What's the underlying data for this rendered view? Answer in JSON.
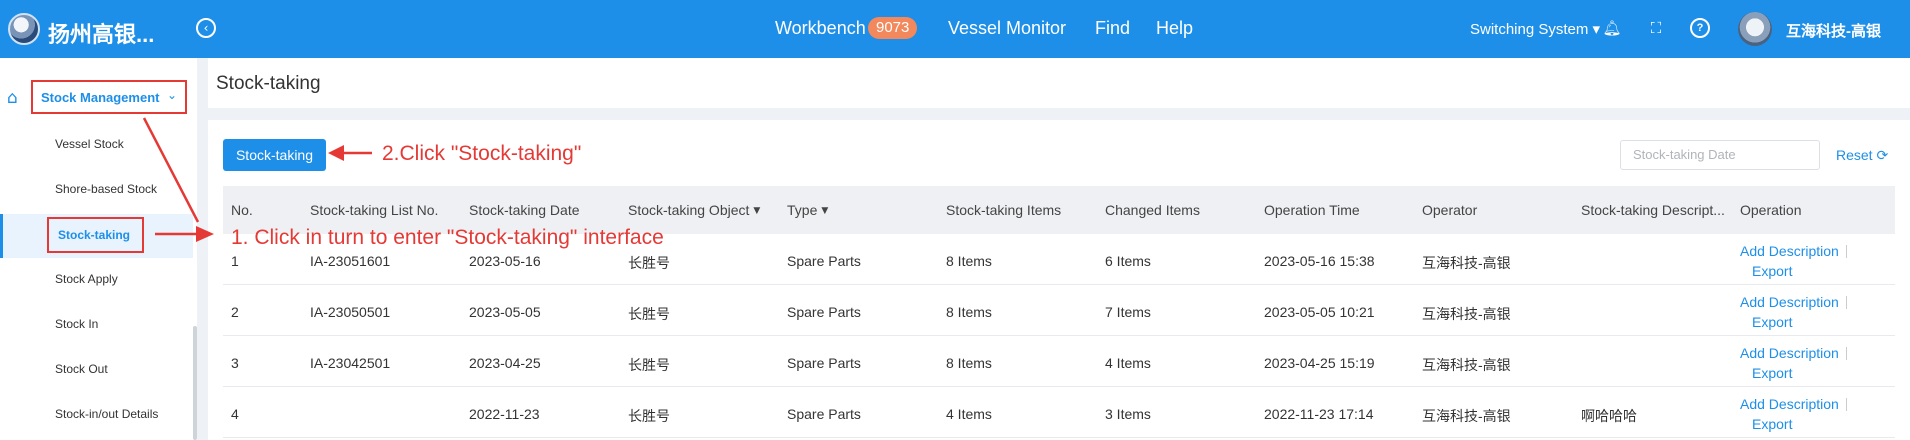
{
  "header": {
    "company": "扬州高银...",
    "nav": [
      {
        "label": "Workbench",
        "badge": "9073"
      },
      {
        "label": "Vessel Monitor"
      },
      {
        "label": "Find"
      },
      {
        "label": "Help"
      }
    ],
    "switching_system": "Switching System ▾",
    "user": "互海科技-高银"
  },
  "sidebar": {
    "group": "Stock Management",
    "items": [
      {
        "label": "Vessel Stock"
      },
      {
        "label": "Shore-based Stock"
      },
      {
        "label": "Stock-taking",
        "active": true
      },
      {
        "label": "Stock Apply"
      },
      {
        "label": "Stock In"
      },
      {
        "label": "Stock Out"
      },
      {
        "label": "Stock-in/out Details"
      }
    ]
  },
  "page": {
    "title": "Stock-taking",
    "primary_button": "Stock-taking",
    "date_placeholder": "Stock-taking Date",
    "reset": "Reset"
  },
  "table": {
    "columns": [
      "No.",
      "Stock-taking List No.",
      "Stock-taking Date",
      "Stock-taking Object",
      "Type",
      "Stock-taking Items",
      "Changed Items",
      "Operation Time",
      "Operator",
      "Stock-taking Descript...",
      "Operation"
    ],
    "rows": [
      {
        "no": "1",
        "list_no": "IA-23051601",
        "date": "2023-05-16",
        "object": "长胜号",
        "type": "Spare Parts",
        "items": "8 Items",
        "changed": "6 Items",
        "op_time": "2023-05-16 15:38",
        "operator": "互海科技-高银",
        "desc": "",
        "action1": "Add Description",
        "action2": "Export"
      },
      {
        "no": "2",
        "list_no": "IA-23050501",
        "date": "2023-05-05",
        "object": "长胜号",
        "type": "Spare Parts",
        "items": "8 Items",
        "changed": "7 Items",
        "op_time": "2023-05-05 10:21",
        "operator": "互海科技-高银",
        "desc": "",
        "action1": "Add Description",
        "action2": "Export"
      },
      {
        "no": "3",
        "list_no": "IA-23042501",
        "date": "2023-04-25",
        "object": "长胜号",
        "type": "Spare Parts",
        "items": "8 Items",
        "changed": "4 Items",
        "op_time": "2023-04-25 15:19",
        "operator": "互海科技-高银",
        "desc": "",
        "action1": "Add Description",
        "action2": "Export"
      },
      {
        "no": "4",
        "list_no": "",
        "date": "2022-11-23",
        "object": "长胜号",
        "type": "Spare Parts",
        "items": "4 Items",
        "changed": "3 Items",
        "op_time": "2022-11-23 17:14",
        "operator": "互海科技-高银",
        "desc": "啊哈哈哈",
        "action1": "Add Description",
        "action2": "Export"
      }
    ]
  },
  "annotations": {
    "step1": "1. Click in turn to enter \"Stock-taking\" interface",
    "step2": "2.Click \"Stock-taking\""
  },
  "colors": {
    "primary": "#1d8fe8",
    "annotation": "#e53935",
    "badge": "#f2885b"
  },
  "icons": [
    "logo",
    "collapse-icon",
    "bell-icon",
    "fullscreen-icon",
    "help-icon",
    "avatar",
    "home-icon",
    "chevron-down-icon",
    "refresh-icon",
    "sort-caret-icon"
  ]
}
